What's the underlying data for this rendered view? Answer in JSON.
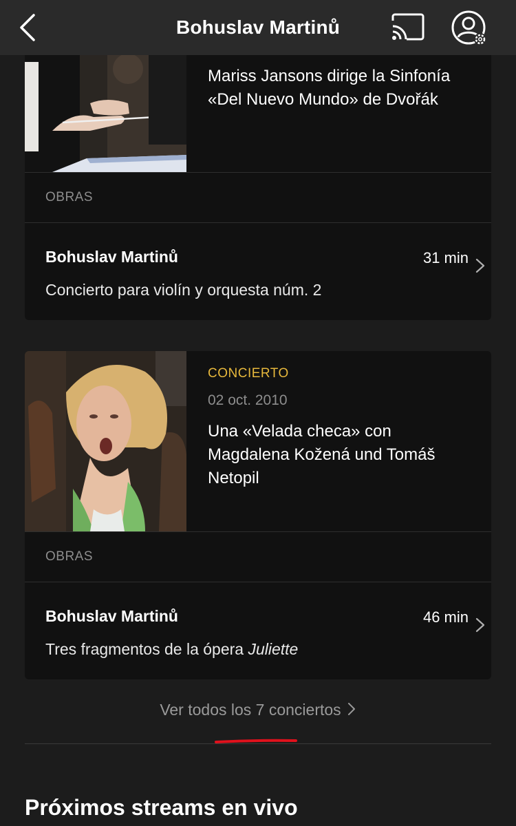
{
  "header": {
    "title": "Bohuslav Martinů",
    "back_icon": "chevron-left-icon",
    "cast_icon": "cast-icon",
    "account_icon": "user-settings-icon"
  },
  "concerts": [
    {
      "title": "Mariss Jansons dirige la Sinfonía «Del Nuevo Mundo» de Dvořák",
      "obras_label": "OBRAS",
      "work": {
        "composer": "Bohuslav Martinů",
        "duration": "31 min",
        "piece": "Concierto para violín y orquesta núm. 2",
        "piece_emphasis": ""
      }
    },
    {
      "kind": "CONCIERTO",
      "date": "02 oct. 2010",
      "title": "Una «Velada checa» con Magdalena Kožená und Tomáš Netopil",
      "obras_label": "OBRAS",
      "work": {
        "composer": "Bohuslav Martinů",
        "duration": "46 min",
        "piece": "Tres fragmentos de la ópera ",
        "piece_emphasis": "Juliette"
      }
    }
  ],
  "view_all": {
    "label": "Ver todos los 7 conciertos"
  },
  "next_section": {
    "title": "Próximos streams en vivo"
  },
  "colors": {
    "accent": "#e7b83c",
    "background": "#1c1c1c",
    "card": "#111111",
    "annotation_underline": "#e0111c"
  }
}
